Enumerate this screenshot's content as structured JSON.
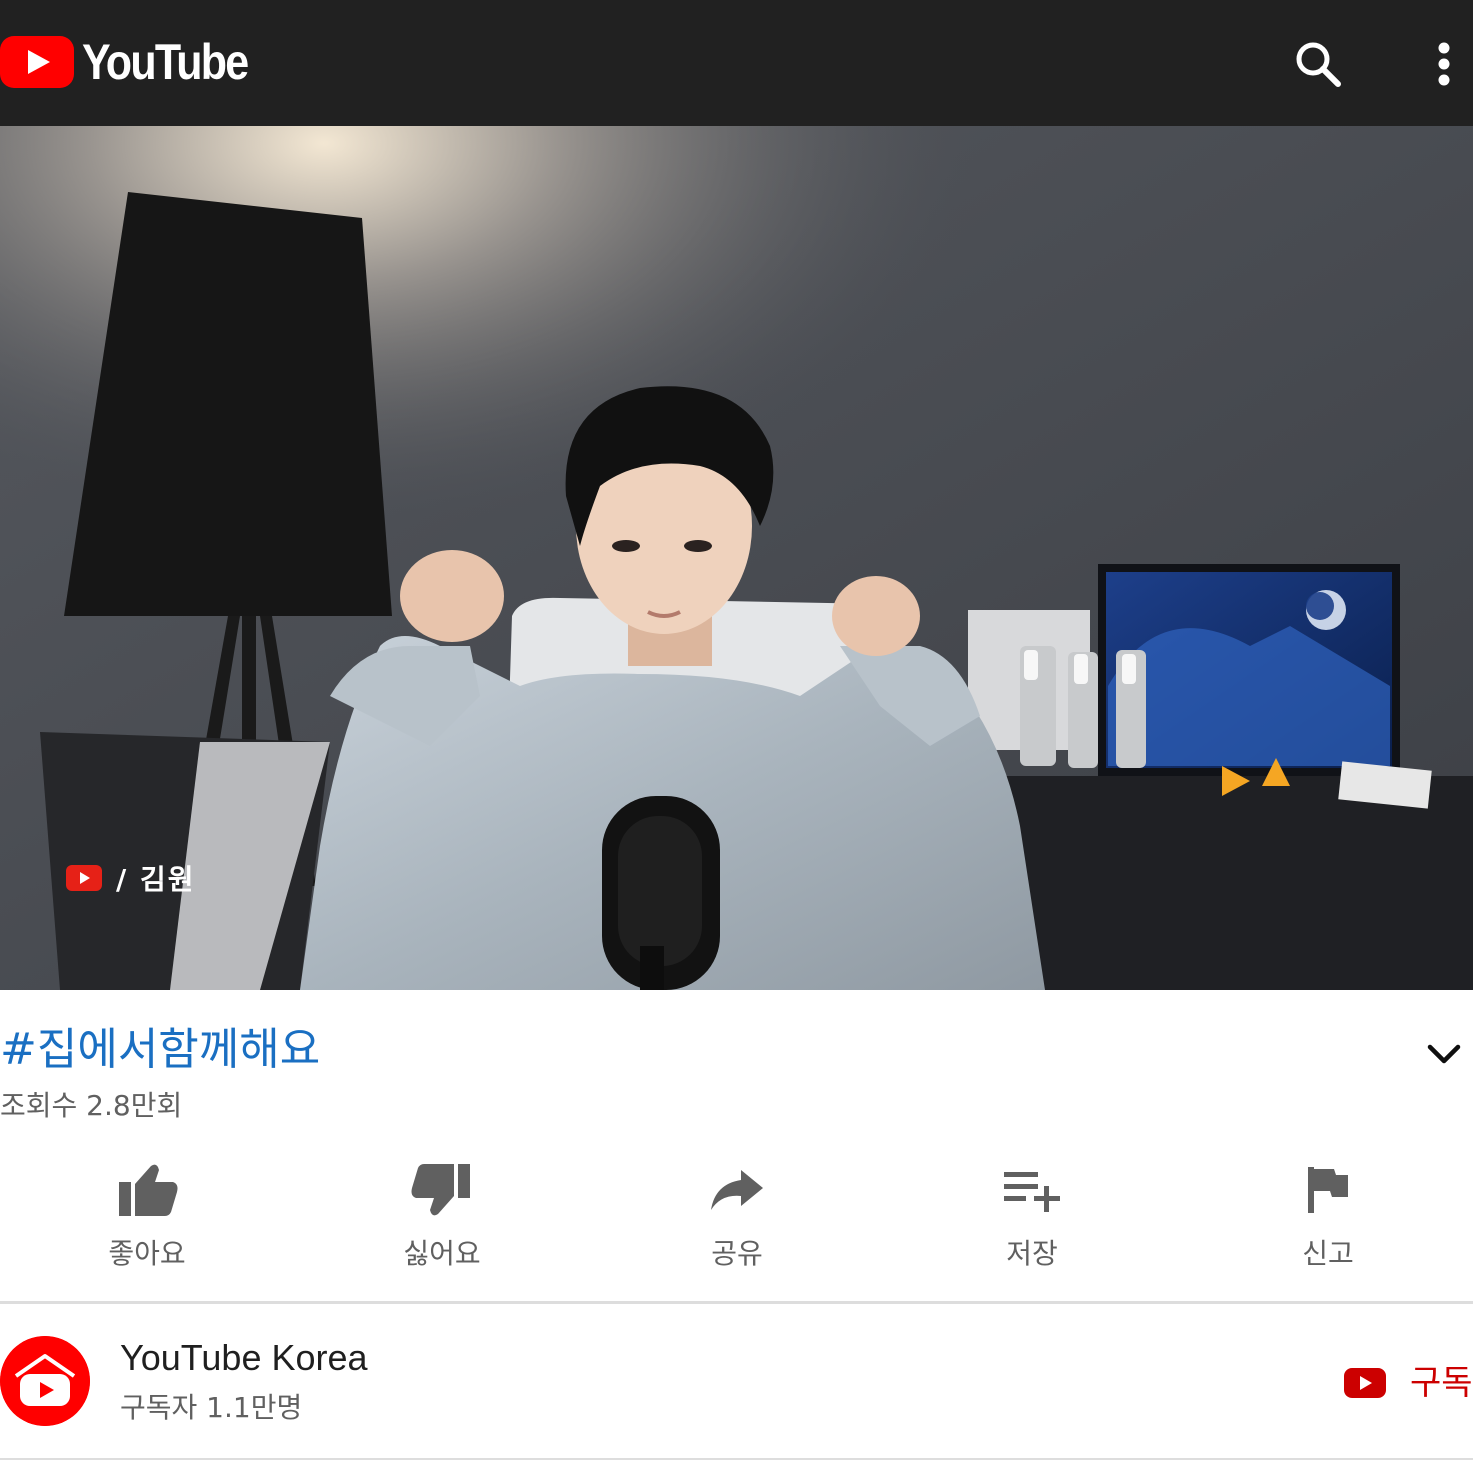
{
  "header": {
    "logo_text": "YouTube",
    "brand_color": "#ff0000",
    "background": "#212121",
    "icons": [
      "youtube-logo-icon",
      "search-icon",
      "more-vert-icon"
    ]
  },
  "video": {
    "overlay_watermark": "/ 김원",
    "overlay_icon": "youtube-play-icon"
  },
  "info": {
    "title": "#집에서함께해요",
    "title_color": "#1a6fc2",
    "views": "조회수 2.8만회",
    "expand_icon": "chevron-down-icon"
  },
  "actions": [
    {
      "label": "좋아요",
      "icon": "thumb-up-icon"
    },
    {
      "label": "싫어요",
      "icon": "thumb-down-icon"
    },
    {
      "label": "공유",
      "icon": "share-icon"
    },
    {
      "label": "저장",
      "icon": "playlist-add-icon"
    },
    {
      "label": "신고",
      "icon": "flag-icon"
    }
  ],
  "channel": {
    "name": "YouTube Korea",
    "subscribers": "구독자 1.1만명",
    "subscribe_label": "구독",
    "subscribe_color": "#cc0000",
    "avatar_icon": "channel-avatar-icon"
  }
}
